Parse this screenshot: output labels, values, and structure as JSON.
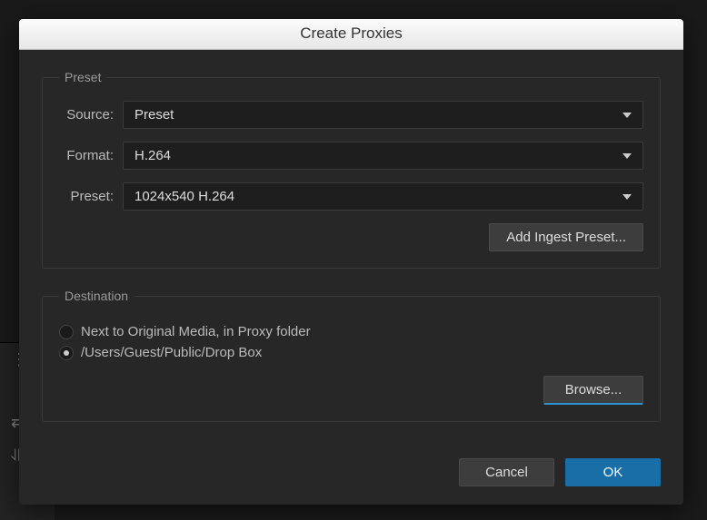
{
  "dialog": {
    "title": "Create Proxies",
    "preset_section": {
      "legend": "Preset",
      "source_label": "Source:",
      "source_value": "Preset",
      "format_label": "Format:",
      "format_value": "H.264",
      "preset_label": "Preset:",
      "preset_value": "1024x540 H.264",
      "add_ingest_button": "Add Ingest Preset..."
    },
    "destination_section": {
      "legend": "Destination",
      "options": [
        {
          "label": "Next to Original Media, in Proxy folder",
          "selected": false
        },
        {
          "label": "/Users/Guest/Public/Drop Box",
          "selected": true
        }
      ],
      "browse_button": "Browse..."
    },
    "footer": {
      "cancel": "Cancel",
      "ok": "OK"
    }
  }
}
